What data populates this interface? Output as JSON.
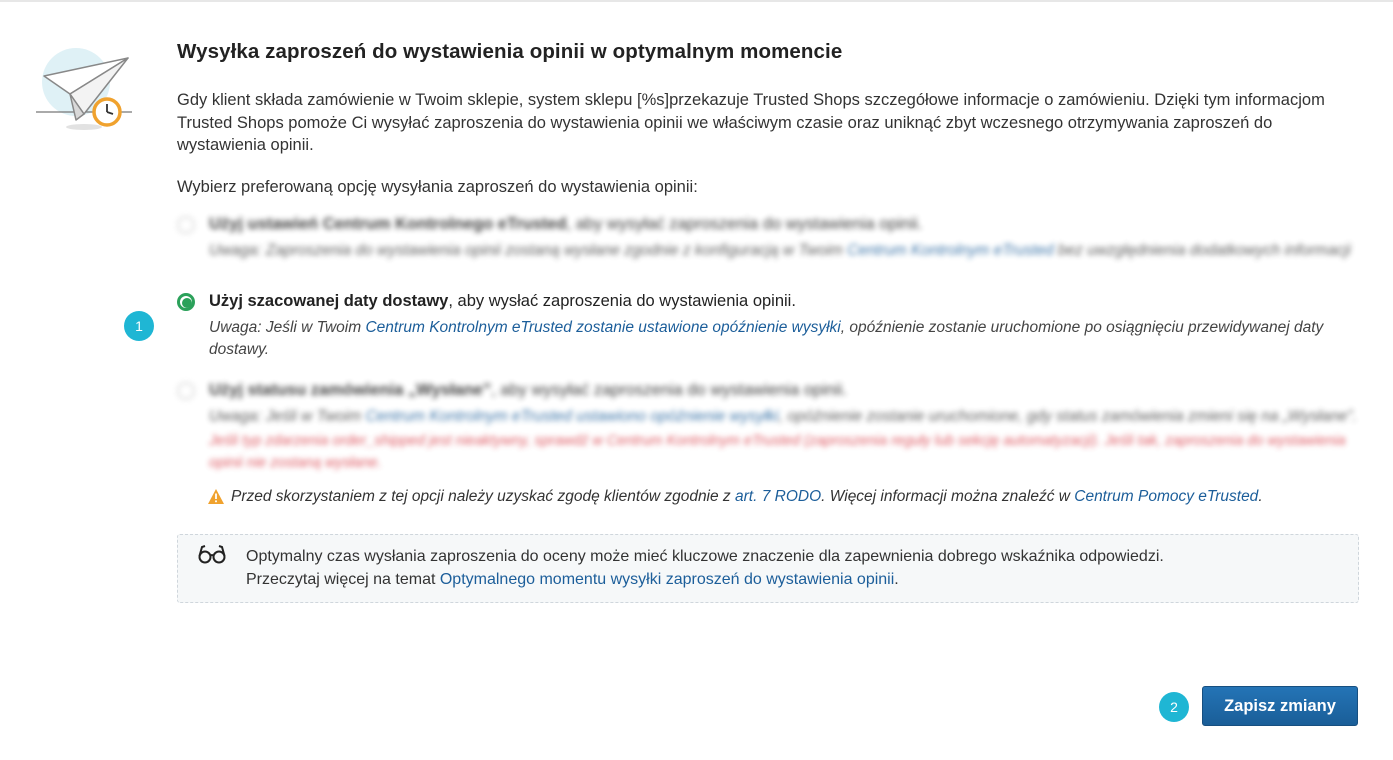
{
  "heading": "Wysyłka zaproszeń do wystawienia opinii w optymalnym momencie",
  "intro": "Gdy klient składa zamówienie w Twoim sklepie, system sklepu [%s]przekazuje Trusted Shops szczegółowe informacje o zamówieniu. Dzięki tym informacjom Trusted Shops pomoże Ci wysyłać zaproszenia do wystawienia opinii we właściwym czasie oraz uniknąć zbyt wczesnego otrzymywania zaproszeń do wystawienia opinii.",
  "prompt": "Wybierz preferowaną opcję wysyłania zaproszeń do wystawienia opinii:",
  "options": [
    {
      "title_bold": "Użyj ustawień Centrum Kontrolnego eTrusted",
      "title_rest": ", aby wysyłać zaproszenia do wystawienia opinii.",
      "note_pre": "Uwaga: Zaproszenia do wystawienia opinii zostaną wysłane zgodnie z konfiguracją w Twoim ",
      "note_link": "Centrum Kontrolnym eTrusted",
      "note_post": " bez uwzględnienia dodatkowych informacji",
      "selected": false
    },
    {
      "title_bold": "Użyj szacowanej daty dostawy",
      "title_rest": ", aby wysłać zaproszenia do wystawienia opinii.",
      "note_pre": "Uwaga: Jeśli w Twoim ",
      "note_link": "Centrum Kontrolnym eTrusted zostanie ustawione opóźnienie wysyłki",
      "note_post": ", opóźnienie zostanie uruchomione po osiągnięciu przewidywanej daty dostawy.",
      "selected": true
    },
    {
      "title_bold": "Użyj statusu zamówienia „Wysłane”",
      "title_rest": ", aby wysyłać zaproszenia do wystawienia opinii.",
      "note_pre": "Uwaga: Jeśli w Twoim ",
      "note_link": "Centrum Kontrolnym eTrusted ustawiono opóźnienie wysyłki",
      "note_post": ", opóźnienie zostanie uruchomione, gdy status zamówienia zmieni się na „Wysłane”.",
      "note_red": "Jeśli typ zdarzenia order_shipped jest nieaktywny, sprawdź w Centrum Kontrolnym eTrusted (zaproszenia reguły lub sekcję automatyzacji). Jeśli tak, zaproszenia do wystawienia opinii nie zostaną wysłane.",
      "selected": false
    }
  ],
  "warning": {
    "pre": "Przed skorzystaniem z tej opcji należy uzyskać zgodę klientów zgodnie z ",
    "link1": "art. 7 RODO",
    "mid": ". Więcej informacji można znaleźć w ",
    "link2": "Centrum Pomocy eTrusted",
    "post": "."
  },
  "info": {
    "line1": "Optymalny czas wysłania zaproszenia do oceny może mieć kluczowe znaczenie dla zapewnienia dobrego wskaźnika odpowiedzi.",
    "line2_pre": "Przeczytaj więcej na temat ",
    "line2_link": "Optymalnego momentu wysyłki zaproszeń do wystawienia opinii",
    "line2_post": "."
  },
  "badges": [
    "1",
    "2"
  ],
  "save_button": "Zapisz zmiany",
  "colors": {
    "accent_blue": "#1c5e9a",
    "radio_green": "#2ba15a",
    "badge_cyan": "#1fb6d4",
    "warning_orange": "#f0a22e",
    "error_red": "#d9404b"
  },
  "icons": [
    "paper-plane-clock-illustration",
    "warning-icon",
    "glasses-icon"
  ]
}
